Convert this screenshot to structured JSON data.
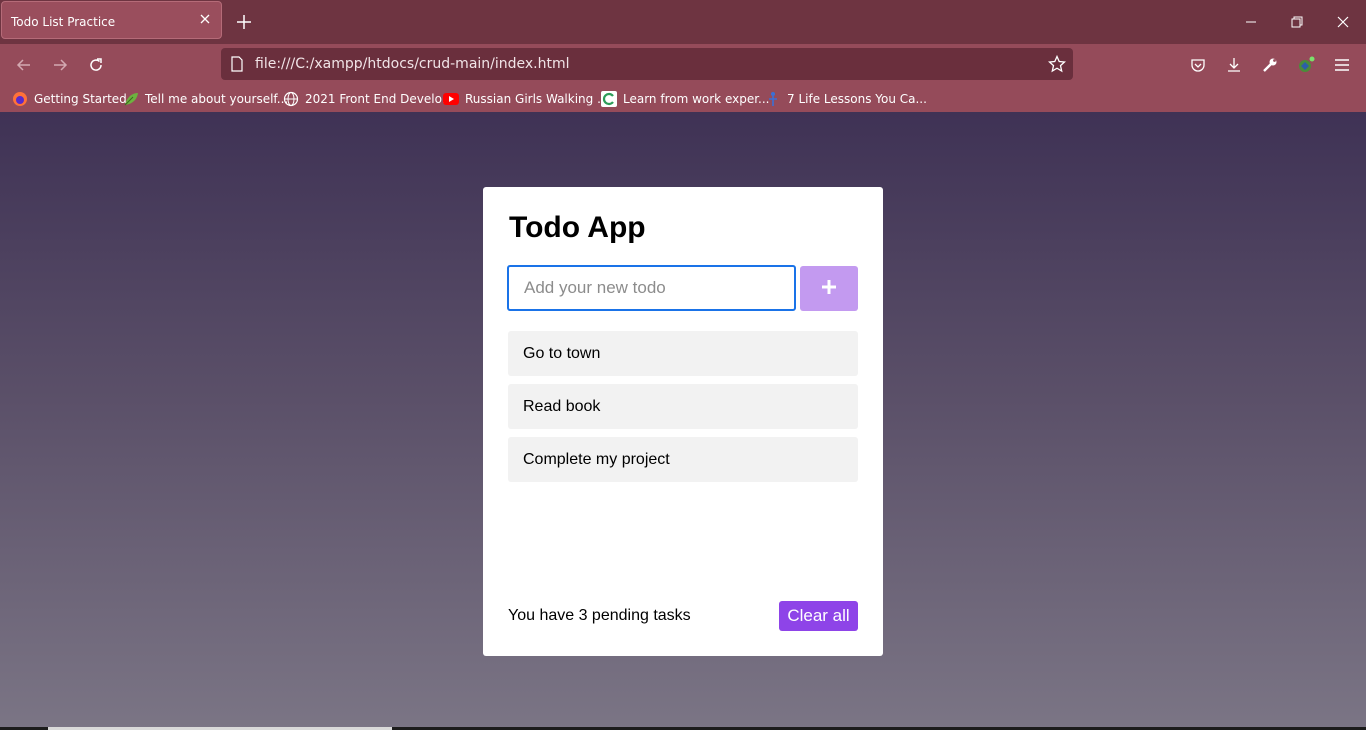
{
  "browser": {
    "tab_title": "Todo List Practice",
    "url": "file:///C:/xampp/htdocs/crud-main/index.html",
    "bookmarks": [
      {
        "label": "Getting Started",
        "icon": "firefox-icon"
      },
      {
        "label": "Tell me about yourself...",
        "icon": "leaf-icon"
      },
      {
        "label": "2021 Front End Develo...",
        "icon": "globe-icon"
      },
      {
        "label": "Russian Girls Walking ...",
        "icon": "youtube-icon"
      },
      {
        "label": "Learn from work exper...",
        "icon": "edu-icon"
      },
      {
        "label": "7 Life Lessons You Ca...",
        "icon": "figure-icon"
      }
    ]
  },
  "app": {
    "title": "Todo App",
    "input_placeholder": "Add your new todo",
    "add_label": "+",
    "todos": [
      "Go to town",
      "Read book",
      "Complete my project"
    ],
    "pending_text": "You have 3 pending tasks",
    "clear_label": "Clear all"
  },
  "colors": {
    "accent": "#8e44e8",
    "add_button": "#c39af0",
    "tab_bar": "#6e3441",
    "toolbar": "#954b5a"
  }
}
